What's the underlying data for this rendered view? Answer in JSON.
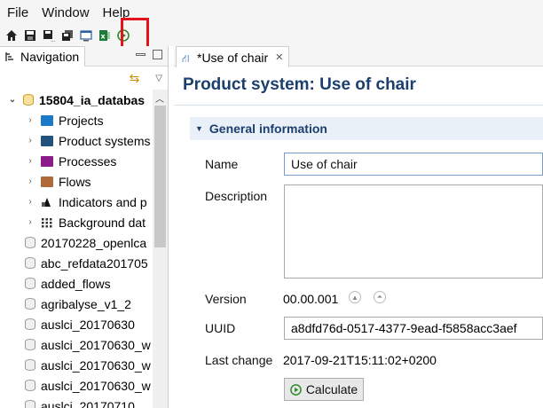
{
  "menubar": {
    "items": [
      "File",
      "Window",
      "Help"
    ]
  },
  "toolbar": {
    "icons": [
      "home-icon",
      "save-icon",
      "save-as-icon",
      "save-all-icon",
      "console-icon",
      "excel-export-icon",
      "run-calculation-icon"
    ]
  },
  "navigation": {
    "tab_label": "Navigation",
    "tree": [
      {
        "label": "15804_ia_databas",
        "level": 0,
        "expanded": true,
        "type": "database-active"
      },
      {
        "label": "Projects",
        "level": 1,
        "type": "folder-blue"
      },
      {
        "label": "Product systems",
        "level": 1,
        "type": "folder-darkblue"
      },
      {
        "label": "Processes",
        "level": 1,
        "type": "folder-purple"
      },
      {
        "label": "Flows",
        "level": 1,
        "type": "folder-brown"
      },
      {
        "label": "Indicators and p",
        "level": 1,
        "type": "indicators"
      },
      {
        "label": "Background dat",
        "level": 1,
        "type": "background"
      },
      {
        "label": "20170228_openlca",
        "level": 0,
        "type": "database"
      },
      {
        "label": "abc_refdata201705",
        "level": 0,
        "type": "database"
      },
      {
        "label": "added_flows",
        "level": 0,
        "type": "database"
      },
      {
        "label": "agribalyse_v1_2",
        "level": 0,
        "type": "database"
      },
      {
        "label": "auslci_20170630",
        "level": 0,
        "type": "database"
      },
      {
        "label": "auslci_20170630_w",
        "level": 0,
        "type": "database"
      },
      {
        "label": "auslci_20170630_w",
        "level": 0,
        "type": "database"
      },
      {
        "label": "auslci_20170630_w",
        "level": 0,
        "type": "database"
      },
      {
        "label": "auslci_20170710",
        "level": 0,
        "type": "database"
      }
    ]
  },
  "editor": {
    "tab_label": "*Use of chair",
    "title": "Product system: Use of chair",
    "section_title": "General information",
    "labels": {
      "name": "Name",
      "description": "Description",
      "version": "Version",
      "uuid": "UUID",
      "last_change": "Last change"
    },
    "values": {
      "name": "Use of chair",
      "description": "",
      "version": "00.00.001",
      "uuid": "a8dfd76d-0517-4377-9ead-f5858acc3aef",
      "last_change": "2017-09-21T15:11:02+0200"
    },
    "calculate_label": "Calculate"
  },
  "colors": {
    "accent_title": "#1c3f6e",
    "highlight": "#e3141c",
    "run_green": "#2e8b2e"
  }
}
